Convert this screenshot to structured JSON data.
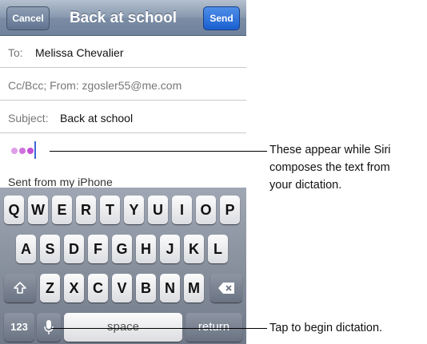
{
  "navbar": {
    "title": "Back at school",
    "cancel_label": "Cancel",
    "send_label": "Send"
  },
  "compose": {
    "to_label": "To:",
    "to_value": "Melissa Chevalier",
    "ccbcc_label": "Cc/Bcc; From: zgosler55@me.com",
    "subject_label": "Subject:",
    "subject_value": "Back at school",
    "signature": "Sent from my iPhone"
  },
  "keyboard": {
    "row1": [
      "Q",
      "W",
      "E",
      "R",
      "T",
      "Y",
      "U",
      "I",
      "O",
      "P"
    ],
    "row2": [
      "A",
      "S",
      "D",
      "F",
      "G",
      "H",
      "J",
      "K",
      "L"
    ],
    "row3": [
      "Z",
      "X",
      "C",
      "V",
      "B",
      "N",
      "M"
    ],
    "numbers_label": "123",
    "space_label": "space",
    "return_label": "return"
  },
  "callouts": {
    "dictation_dots": "These appear while Siri composes the text from your dictation.",
    "dictation_dots_lines": [
      "These appear while Siri",
      "composes the text from",
      "your dictation."
    ],
    "mic_key": "Tap to begin dictation."
  },
  "colors": {
    "dot_color": "#c24fd6",
    "cursor_color": "#3c67d6",
    "send_button": "#1a5fd0"
  },
  "icons": {
    "shift": "shift-icon",
    "delete": "delete-icon",
    "microphone": "microphone-icon"
  }
}
